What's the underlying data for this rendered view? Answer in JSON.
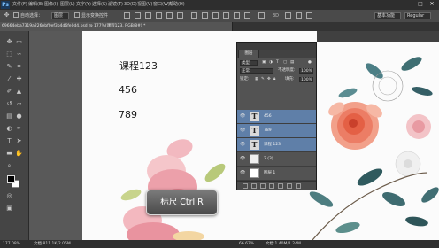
{
  "app": {
    "logo": "Ps"
  },
  "menubar": {
    "items": [
      "文件(F)",
      "编辑(E)",
      "图像(I)",
      "图层(L)",
      "文字(Y)",
      "选择(S)",
      "滤镜(T)",
      "3D(D)",
      "视图(V)",
      "窗口(W)",
      "帮助(H)"
    ],
    "window_controls": {
      "minimize": "–",
      "maximize": "□",
      "close": "✕"
    }
  },
  "options_bar": {
    "auto_select_label": "自动选择：",
    "auto_select_value": "图层",
    "transform_label": "显示变换控件",
    "workspace_value": "基本功能",
    "mode_value": "Regular"
  },
  "document": {
    "tab_title": "69664eba7319a226ebf0ef3b4d6fe0d4.psd @ 177%(课程123, RGB/8#) *"
  },
  "canvas": {
    "texts": [
      "课程123",
      "456",
      "789"
    ]
  },
  "layers_panel": {
    "title": "图层",
    "filter_kind": "类型",
    "blend_mode": "正常",
    "opacity_label": "不透明度:",
    "opacity_value": "100%",
    "lock_label": "锁定:",
    "fill_label": "填充:",
    "fill_value": "100%",
    "layers": [
      {
        "name": "456",
        "type": "text",
        "selected": true
      },
      {
        "name": "789",
        "type": "text",
        "selected": true
      },
      {
        "name": "课程 123",
        "type": "text",
        "selected": true
      },
      {
        "name": "2 (3)",
        "type": "image",
        "selected": false
      },
      {
        "name": "图层 1",
        "type": "image",
        "selected": false
      }
    ],
    "tab_icons": [
      "eye-icon",
      "link-icon",
      "fx-icon",
      "mask-icon",
      "adjustment-icon",
      "folder-icon",
      "new-layer-icon",
      "trash-icon"
    ]
  },
  "caption": {
    "text": "标尺  Ctrl  R"
  },
  "status_bar": {
    "zoom": "177.08%",
    "doc_left": "文档:811.1K/2.06M",
    "zoom_right": "66.67%",
    "doc_right": "文档:1.40M/1.24M"
  },
  "colors": {
    "selection_blue": "#5f7fa8",
    "canvas_bg": "#fbfbfb",
    "chrome_dark": "#2e2e2e"
  }
}
